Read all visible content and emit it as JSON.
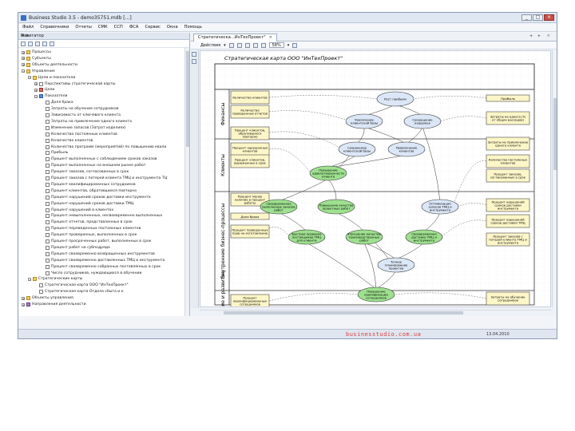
{
  "window": {
    "title": "Business Studio 3.5 - demo35751.mdb [...]",
    "controls": {
      "minimize": "_",
      "maximize": "□",
      "close": "×"
    }
  },
  "menu": [
    "Файл",
    "Справочники",
    "Отчеты",
    "СМК",
    "ССП",
    "ФСА",
    "Сервис",
    "Окна",
    "Помощь"
  ],
  "navigator": {
    "title": "Навигатор",
    "pin": "⊕ ×",
    "tree": [
      {
        "label": "Процессы",
        "expander": "+",
        "icon": "folder"
      },
      {
        "label": "Субъекты",
        "expander": "+",
        "icon": "folder"
      },
      {
        "label": "Объекты деятельности",
        "expander": "+",
        "icon": "folder"
      },
      {
        "label": "Управление",
        "expander": "−",
        "icon": "folder"
      },
      {
        "label": "Цели и показатели",
        "expander": "−",
        "icon": "folder"
      },
      {
        "label": "Перспективы стратегической карты",
        "expander": "+",
        "icon": "doc"
      },
      {
        "label": "Цели",
        "expander": "+",
        "icon": "red"
      },
      {
        "label": "Показатели",
        "expander": "−",
        "icon": "blue"
      },
      {
        "label": "Доля брака",
        "expander": "",
        "icon": "doc"
      },
      {
        "label": "Затраты на обучение сотрудников",
        "expander": "",
        "icon": "doc"
      },
      {
        "label": "Зависимость от ключевого клиента",
        "expander": "",
        "icon": "doc"
      },
      {
        "label": "Затраты на привлечение одного клиента",
        "expander": "",
        "icon": "doc"
      },
      {
        "label": "Изменение запасов (Затрат изделиях)",
        "expander": "",
        "icon": "doc"
      },
      {
        "label": "Количество постоянных клиентов",
        "expander": "",
        "icon": "doc"
      },
      {
        "label": "Количество клиентов",
        "expander": "",
        "icon": "doc"
      },
      {
        "label": "Количество программ (мероприятий) по повышению квали",
        "expander": "",
        "icon": "doc"
      },
      {
        "label": "Прибыль",
        "expander": "",
        "icon": "doc"
      },
      {
        "label": "Процент выполненных с соблюдением сроков заказов",
        "expander": "",
        "icon": "doc"
      },
      {
        "label": "Процент выполненных на внешнем рынке работ",
        "expander": "",
        "icon": "doc"
      },
      {
        "label": "Процент заказов, согласованных в срок",
        "expander": "",
        "icon": "doc"
      },
      {
        "label": "Процент заказов с потерей клиента ТМЦ и инструмента ТЦ",
        "expander": "",
        "icon": "doc"
      },
      {
        "label": "Процент квалифицированных сотрудников",
        "expander": "",
        "icon": "doc"
      },
      {
        "label": "Процент клиентов, обратившихся повторно",
        "expander": "",
        "icon": "doc"
      },
      {
        "label": "Процент нарушений сроков доставки инструмента",
        "expander": "",
        "icon": "doc"
      },
      {
        "label": "Процент нарушений сроков доставки ТМЦ",
        "expander": "",
        "icon": "doc"
      },
      {
        "label": "Процент нарушений в клиентах",
        "expander": "",
        "icon": "doc"
      },
      {
        "label": "Процент невыполненных, несвоевременно выполненных",
        "expander": "",
        "icon": "doc"
      },
      {
        "label": "Процент отчетов, представленных в срок",
        "expander": "",
        "icon": "doc"
      },
      {
        "label": "Процент переведенных постоянных клиентов",
        "expander": "",
        "icon": "doc"
      },
      {
        "label": "Процент проверенных, выполненных в срок",
        "expander": "",
        "icon": "doc"
      },
      {
        "label": "Процент просроченных работ, выполненных в срок",
        "expander": "",
        "icon": "doc"
      },
      {
        "label": "Процент работ на субподряде",
        "expander": "",
        "icon": "doc"
      },
      {
        "label": "Процент своевременно возвращенных инструментов",
        "expander": "",
        "icon": "doc"
      },
      {
        "label": "Процент своевременно доставленных ТМЦ и инструмента",
        "expander": "",
        "icon": "doc"
      },
      {
        "label": "Процент своевременно собранных поставленных в срок",
        "expander": "",
        "icon": "doc"
      },
      {
        "label": "Число сотрудников, нуждающихся в обучении",
        "expander": "",
        "icon": "doc"
      },
      {
        "label": "Стратегические карты",
        "expander": "−",
        "icon": "folder"
      },
      {
        "label": "Стратегическая карта ООО \"ИнТехПроект\"",
        "expander": "",
        "icon": "doc"
      },
      {
        "label": "Стратегическая карта Отдела сбыта и к",
        "expander": "",
        "icon": "doc"
      },
      {
        "label": "Объекты управления",
        "expander": "+",
        "icon": "folder"
      },
      {
        "label": "Направления деятельности",
        "expander": "+",
        "icon": "purple"
      }
    ]
  },
  "document": {
    "tab_label": "Стратегическа...ИнТехПроект\"",
    "tab_close": "×",
    "tab_nav": "◂ ▸ ×",
    "toolbar_default": "Действия",
    "zoom": "58%",
    "map_title": "Стратегическая карта ООО \"ИнТехПроект\"",
    "lanes": [
      "Финансы",
      "Клиенты",
      "Внутренние бизнес-процессы",
      "Обучение и развитие"
    ],
    "left_boxes": [
      "Количество клиентов",
      "Количество проверенных отчетов",
      "Процент клиентов, обратившихся повторно",
      "Процент нарушенных клиентов",
      "Процент клиентов, выраженных в срок",
      "Процент менее наличие в процент работы",
      "Доля брака",
      "Процент проверенных прав на изготовление",
      "Процент квалифицированных сотрудников"
    ],
    "right_boxes": [
      "Прибыль",
      "Затраты на одного (% от общих расходов)",
      "Затраты на привлечение одного клиента",
      "Количество постоянных клиентов",
      "Процент заказов, согласованных в срок",
      "Процент нарушений сроков доставки инструмента",
      "Процент нарушений сроков доставки ТМЦ",
      "Процент заказов с потерей клиента ТМЦ и инструмента",
      "Затраты на обучение сотрудников"
    ],
    "goals": [
      "Рост прибыли",
      "Увеличение клиентской базы",
      "Сокращение издержек",
      "Сохранение клиентской базы",
      "Привлечение клиентов",
      "Повышение удовлетворенности клиента",
      "Своевременное выполнение заказов работ",
      "Повышение качества проектных работ",
      "Оптимизация запасов ТМЦ и инструмента",
      "Быстрая проверка поставщиков ТМЦ для клиента",
      "Улучшение качества производственных работ",
      "Своевременная доставка ТМЦ и инструмента",
      "Точное планирование проектов",
      "Повышение квалификации сотрудников"
    ]
  },
  "status": {
    "watermark": "businesstudio.com.ua",
    "date": "13.04.2010"
  }
}
